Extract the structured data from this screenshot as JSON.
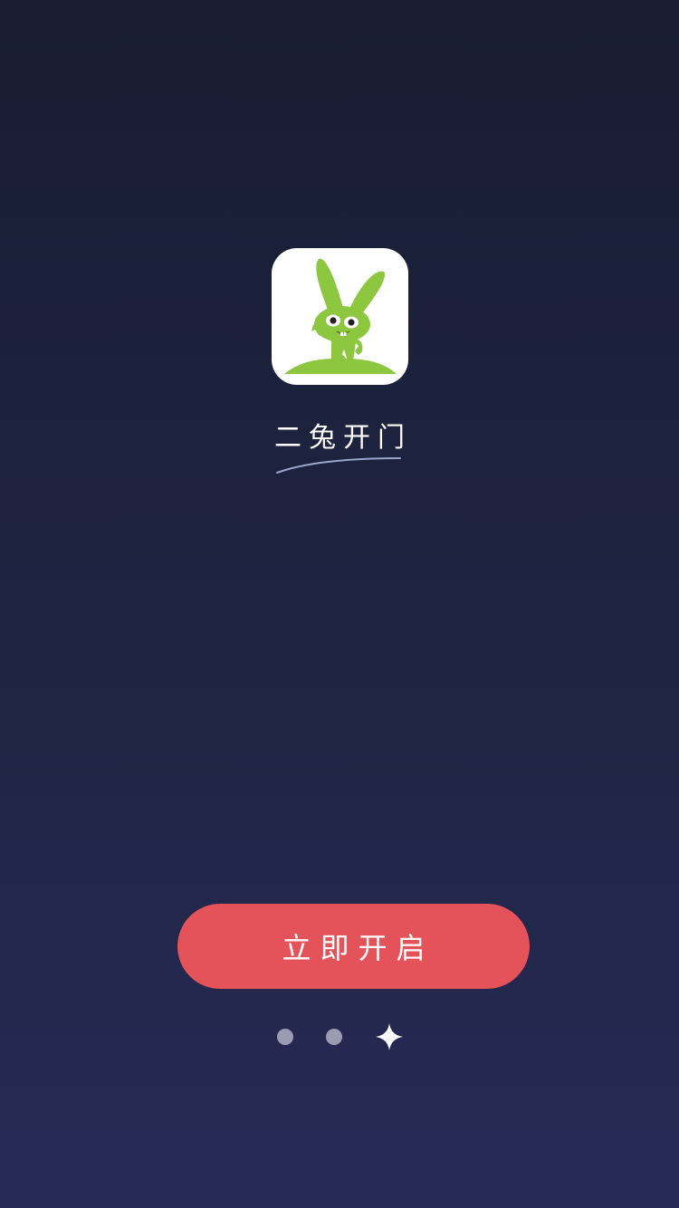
{
  "app": {
    "name": "二兔开门",
    "logo_icon": "green-rabbit-icon",
    "logo_color": "#8dc63f"
  },
  "cta": {
    "label": "立即开启",
    "color": "#e4525a"
  },
  "pagination": {
    "total_pages": 3,
    "current_page": 3,
    "active_icon": "sparkle-star-icon",
    "inactive_icon": "dot-icon"
  },
  "theme": {
    "background_top": "#181d33",
    "background_bottom": "#272a55"
  }
}
